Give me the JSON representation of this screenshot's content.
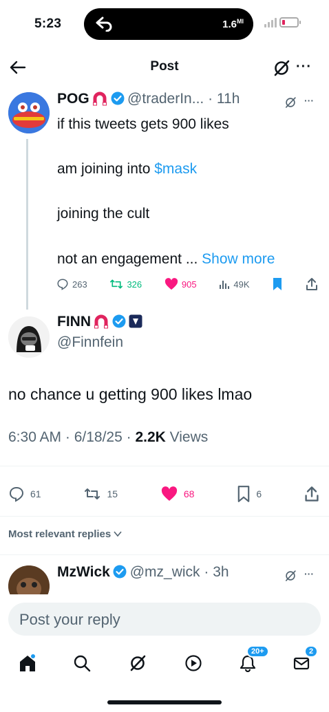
{
  "status_bar": {
    "time": "5:23",
    "data_rate": "1.6",
    "data_unit": "MI",
    "icons": [
      "back-arrow-icon",
      "signal-icon",
      "battery-icon"
    ]
  },
  "header": {
    "title": "Post",
    "icons": [
      "back-arrow-icon",
      "grok-icon",
      "more-icon"
    ]
  },
  "parent_tweet": {
    "name": "POG",
    "handle": "@traderIn...",
    "time": "11h",
    "lines": [
      "if this tweets gets 900 likes",
      "am joining into ",
      "$mask",
      "joining the cult",
      "not an engagement ...",
      "Show more"
    ],
    "stats": {
      "replies": "263",
      "retweets": "326",
      "likes": "905",
      "views": "49K"
    }
  },
  "main_tweet": {
    "name": "FINN",
    "handle": "@Finnfein",
    "text": "no chance u getting 900 likes lmao",
    "timestamp": "6:30 AM · 6/18/25 · ",
    "views_count": "2.2K",
    "views_label": " Views",
    "stats": {
      "replies": "61",
      "retweets": "15",
      "likes": "68",
      "bookmarks": "6"
    }
  },
  "replies": {
    "filter_label": "Most relevant replies",
    "first": {
      "name": "MzWick",
      "handle": "@mz_wick",
      "time": "3h"
    }
  },
  "composer": {
    "placeholder": "Post your reply"
  },
  "bottom_nav": {
    "items": [
      "home-icon",
      "search-icon",
      "grok-icon",
      "video-icon",
      "notifications-icon",
      "messages-icon"
    ],
    "notifications_badge": "20+",
    "messages_badge": "2"
  },
  "colors": {
    "accent": "#1d9bf0",
    "like": "#f91880",
    "retweet": "#00ba7c",
    "text": "#0f1419",
    "secondary": "#536471"
  }
}
